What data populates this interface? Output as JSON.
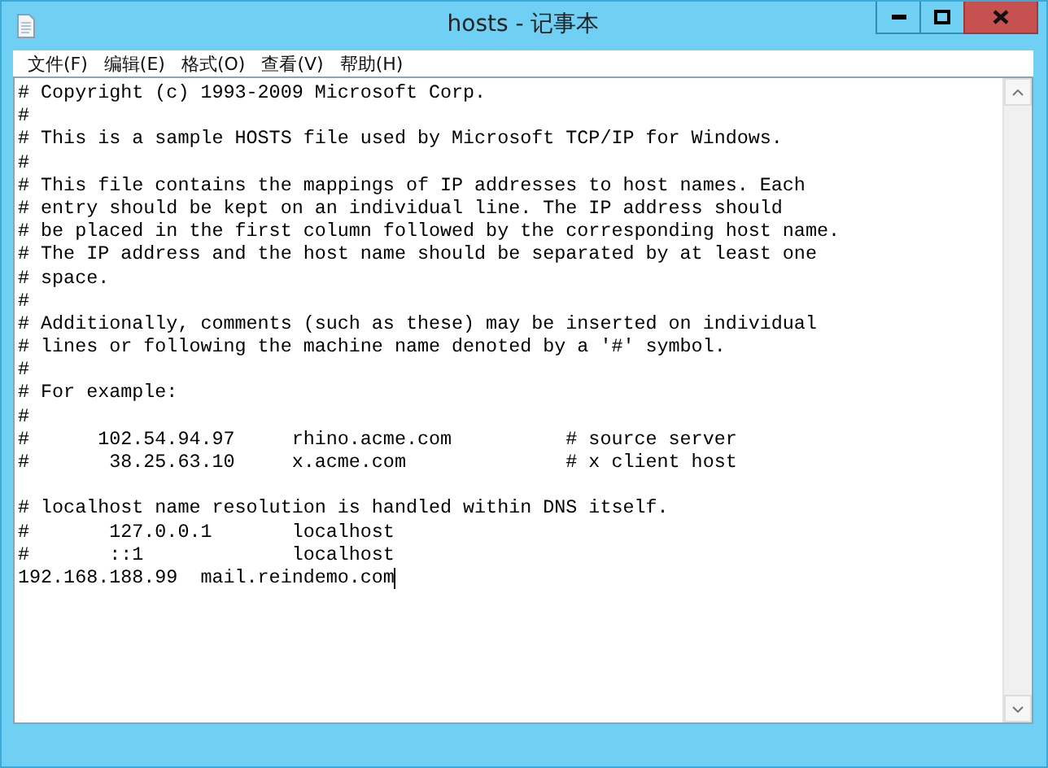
{
  "window": {
    "title": "hosts - 记事本"
  },
  "menu": [
    "文件(F)",
    "编辑(E)",
    "格式(O)",
    "查看(V)",
    "帮助(H)"
  ],
  "editor": {
    "paragraphs": [
      [
        "# Copyright (c) 1993-2009 Microsoft Corp.",
        "#",
        "# This is a sample HOSTS file used by Microsoft TCP/IP for Windows.",
        "#",
        "# This file contains the mappings of IP addresses to host names. Each",
        "# entry should be kept on an individual line. The IP address should",
        "# be placed in the first column followed by the corresponding host name.",
        "# The IP address and the host name should be separated by at least one",
        "# space.",
        "#",
        "# Additionally, comments (such as these) may be inserted on individual",
        "# lines or following the machine name denoted by a '#' symbol.",
        "#",
        "# For example:",
        "#",
        "#      102.54.94.97     rhino.acme.com          # source server",
        "#       38.25.63.10     x.acme.com              # x client host"
      ],
      [
        "# localhost name resolution is handled within DNS itself.",
        "#       127.0.0.1       localhost",
        "#       ::1             localhost",
        "192.168.188.99  mail.reindemo.com"
      ]
    ]
  }
}
